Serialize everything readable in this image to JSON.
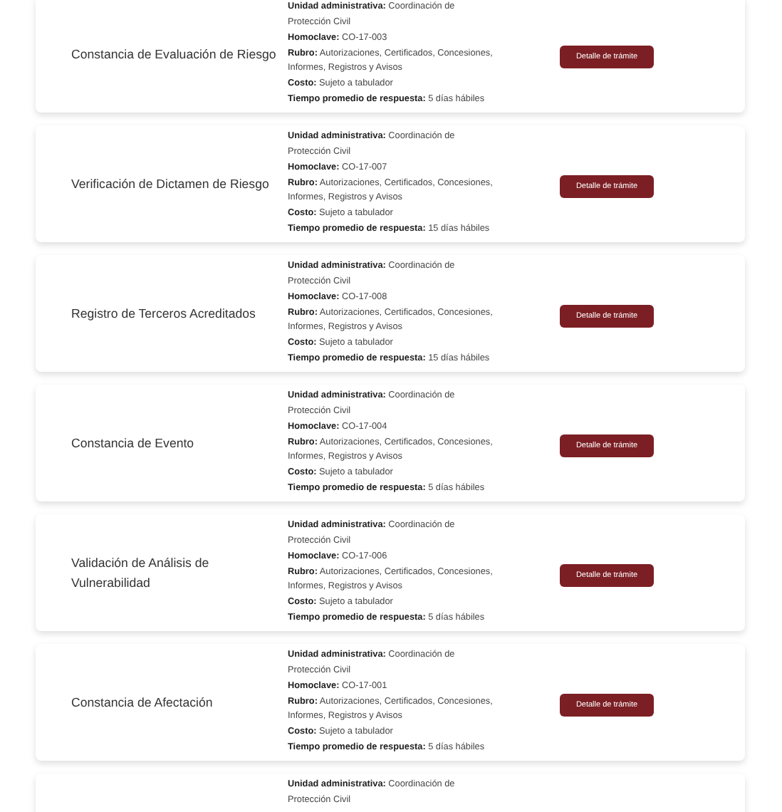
{
  "tramites": [
    {
      "title": "Constancia de Evaluación de Riesgo",
      "details": [
        "**Unidad administrativa:** Coordinación de Protección Civil",
        "**Homoclave:** CO-17-003",
        "**Rubro:** Autorizaciones, Certificados, Concesiones, Informes, Registros y Avisos",
        "**Costo:** Sujeto a tabulador",
        "**Tiempo promedio de respuesta:** 5 días hábiles"
      ],
      "button": "Detalle de trámite"
    },
    {
      "title": "Verificación de Dictamen de Riesgo",
      "details": [
        "**Unidad administrativa:** Coordinación de Protección Civil",
        "**Homoclave:** CO-17-007",
        "**Rubro:** Autorizaciones, Certificados, Concesiones, Informes, Registros y Avisos",
        "**Costo:** Sujeto a tabulador",
        "**Tiempo promedio de respuesta:** 15 días hábiles"
      ],
      "button": "Detalle de trámite"
    },
    {
      "title": "Registro de Terceros Acreditados",
      "details": [
        "**Unidad administrativa:** Coordinación de Protección Civil",
        "**Homoclave:** CO-17-008",
        "**Rubro:** Autorizaciones, Certificados, Concesiones, Informes, Registros y Avisos",
        "**Costo:** Sujeto a tabulador",
        "**Tiempo promedio de respuesta:** 15 días hábiles"
      ],
      "button": "Detalle de trámite"
    },
    {
      "title": "Constancia de Evento",
      "details": [
        "**Unidad administrativa:** Coordinación de Protección Civil",
        "**Homoclave:** CO-17-004",
        "**Rubro:** Autorizaciones, Certificados, Concesiones, Informes, Registros y Avisos",
        "**Costo:** Sujeto a tabulador",
        "**Tiempo promedio de respuesta:** 5 días hábiles"
      ],
      "button": "Detalle de trámite"
    },
    {
      "title": "Validación de Análisis de Vulnerabilidad",
      "details": [
        "**Unidad administrativa:** Coordinación de Protección Civil",
        "**Homoclave:** CO-17-006",
        "**Rubro:** Autorizaciones, Certificados, Concesiones, Informes, Registros y Avisos",
        "**Costo:** Sujeto a tabulador",
        "**Tiempo promedio de respuesta:** 5 días hábiles"
      ],
      "button": "Detalle de trámite"
    },
    {
      "title": "Constancia de Afectación",
      "details": [
        "**Unidad administrativa:** Coordinación de Protección Civil",
        "**Homoclave:** CO-17-001",
        "**Rubro:** Autorizaciones, Certificados, Concesiones, Informes, Registros y Avisos",
        "**Costo:** Sujeto a tabulador",
        "**Tiempo promedio de respuesta:** 5 días hábiles"
      ],
      "button": "Detalle de trámite"
    },
    {
      "details": [
        "**Unidad administrativa:** Coordinación de Protección Civil"
      ]
    }
  ]
}
